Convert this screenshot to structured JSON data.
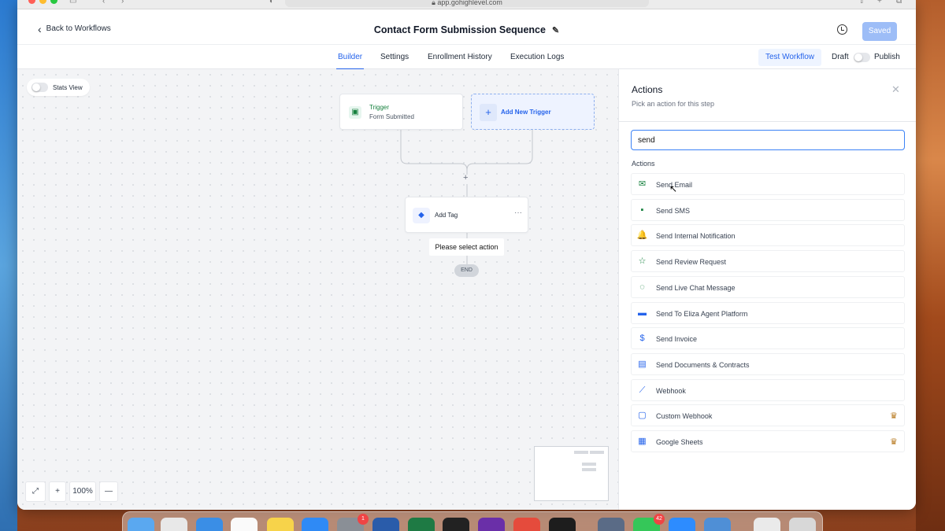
{
  "browser": {
    "url": "app.gohighlevel.com"
  },
  "header": {
    "back_label": "Back to Workflows",
    "title": "Contact Form Submission Sequence",
    "saved_label": "Saved"
  },
  "tabs": [
    {
      "label": "Builder",
      "active": true
    },
    {
      "label": "Settings",
      "active": false
    },
    {
      "label": "Enrollment History",
      "active": false
    },
    {
      "label": "Execution Logs",
      "active": false
    }
  ],
  "toolbar": {
    "test_label": "Test Workflow",
    "draft_label": "Draft",
    "publish_label": "Publish"
  },
  "canvas": {
    "stats_label": "Stats View",
    "trigger_title": "Trigger",
    "trigger_sub": "Form Submitted",
    "add_trigger_label": "Add New Trigger",
    "add_tag_label": "Add Tag",
    "more_label": "···",
    "please_select": "Please select action",
    "end_label": "END",
    "zoom_label": "100%",
    "plus": "+",
    "minus": "—"
  },
  "panel": {
    "title": "Actions",
    "subtitle": "Pick an action for this step",
    "search_value": "send",
    "section_label": "Actions",
    "items": [
      {
        "label": "Send Email",
        "icon": "email-icon",
        "glyph": "✉",
        "color": "#15803d",
        "premium": false
      },
      {
        "label": "Send SMS",
        "icon": "sms-icon",
        "glyph": "▪",
        "color": "#15803d",
        "premium": false
      },
      {
        "label": "Send Internal Notification",
        "icon": "bell-icon",
        "glyph": "🔔",
        "color": "#15803d",
        "premium": false
      },
      {
        "label": "Send Review Request",
        "icon": "star-icon",
        "glyph": "☆",
        "color": "#15803d",
        "premium": false
      },
      {
        "label": "Send Live Chat Message",
        "icon": "chat-icon",
        "glyph": "◌",
        "color": "#15803d",
        "premium": false
      },
      {
        "label": "Send To Eliza Agent Platform",
        "icon": "message-icon",
        "glyph": "▬",
        "color": "#2563eb",
        "premium": false
      },
      {
        "label": "Send Invoice",
        "icon": "dollar-icon",
        "glyph": "$",
        "color": "#2563eb",
        "premium": false
      },
      {
        "label": "Send Documents & Contracts",
        "icon": "document-icon",
        "glyph": "▤",
        "color": "#2563eb",
        "premium": false
      },
      {
        "label": "Webhook",
        "icon": "webhook-icon",
        "glyph": "⟋",
        "color": "#2563eb",
        "premium": false
      },
      {
        "label": "Custom Webhook",
        "icon": "file-icon",
        "glyph": "▢",
        "color": "#2563eb",
        "premium": true
      },
      {
        "label": "Google Sheets",
        "icon": "sheets-icon",
        "glyph": "▦",
        "color": "#2563eb",
        "premium": true
      }
    ]
  },
  "colors": {
    "accent": "#2563eb",
    "saved_button": "#9dbdf7",
    "trigger_green": "#15803d"
  },
  "dock": {
    "badges": [
      "1",
      "42"
    ]
  }
}
